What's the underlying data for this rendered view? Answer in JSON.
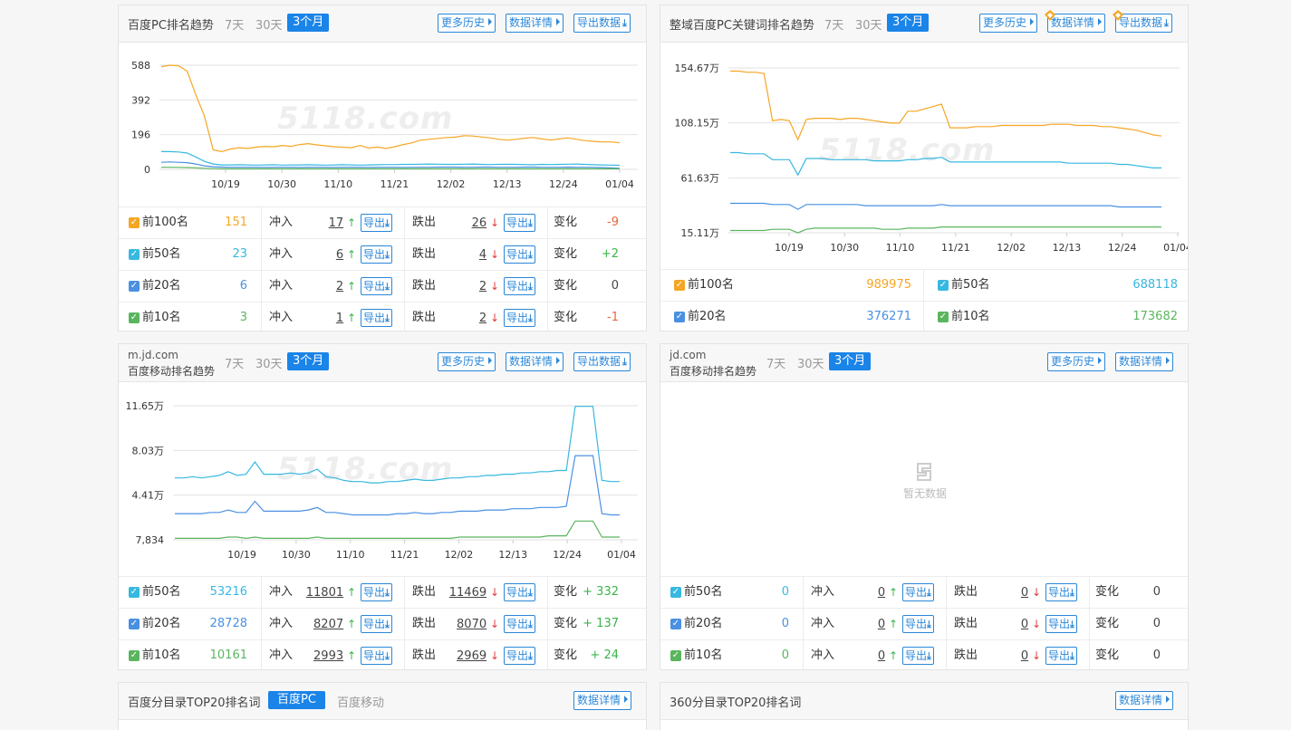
{
  "colors": {
    "orange": "#f5a623",
    "cyan": "#37b8e0",
    "blue": "#4a90e2",
    "green": "#5ab55e",
    "accent": "#1a84e8",
    "red": "#e23b3b",
    "up": "#3ab54a"
  },
  "watermark": "5118.com",
  "panel_tl": {
    "title": "百度PC排名趋势",
    "periods": [
      "7天",
      "30天",
      "3个月"
    ],
    "btn_more": "更多历史",
    "btn_detail": "数据详情",
    "btn_export": "导出数据",
    "rows": [
      {
        "label": "前100名",
        "count": "151",
        "in_label": "冲入",
        "in_val": "17",
        "export": "导出",
        "out_label": "跌出",
        "out_val": "26",
        "change_label": "变化",
        "change": "-9",
        "color": "#f5a623"
      },
      {
        "label": "前50名",
        "count": "23",
        "in_label": "冲入",
        "in_val": "6",
        "export": "导出",
        "out_label": "跌出",
        "out_val": "4",
        "change_label": "变化",
        "change": "+2",
        "color": "#37b8e0"
      },
      {
        "label": "前20名",
        "count": "6",
        "in_label": "冲入",
        "in_val": "2",
        "export": "导出",
        "out_label": "跌出",
        "out_val": "2",
        "change_label": "变化",
        "change": "0",
        "color": "#4a90e2"
      },
      {
        "label": "前10名",
        "count": "3",
        "in_label": "冲入",
        "in_val": "1",
        "export": "导出",
        "out_label": "跌出",
        "out_val": "2",
        "change_label": "变化",
        "change": "-1",
        "color": "#5ab55e"
      }
    ]
  },
  "panel_tr": {
    "title": "整域百度PC关键词排名趋势",
    "periods": [
      "7天",
      "30天",
      "3个月"
    ],
    "btn_more": "更多历史",
    "btn_detail": "数据详情",
    "btn_export": "导出数据",
    "stats": [
      {
        "label": "前100名",
        "value": "989975",
        "color": "#f5a623"
      },
      {
        "label": "前50名",
        "value": "688118",
        "color": "#37b8e0"
      },
      {
        "label": "前20名",
        "value": "376271",
        "color": "#4a90e2"
      },
      {
        "label": "前10名",
        "value": "173682",
        "color": "#5ab55e"
      }
    ]
  },
  "panel_ml": {
    "domain": "m.jd.com",
    "title": "百度移动排名趋势",
    "periods": [
      "7天",
      "30天",
      "3个月"
    ],
    "btn_more": "更多历史",
    "btn_detail": "数据详情",
    "btn_export": "导出数据",
    "rows": [
      {
        "label": "前50名",
        "count": "53216",
        "in_label": "冲入",
        "in_val": "11801",
        "export": "导出",
        "out_label": "跌出",
        "out_val": "11469",
        "change_label": "变化",
        "change": "+ 332",
        "color": "#37b8e0"
      },
      {
        "label": "前20名",
        "count": "28728",
        "in_label": "冲入",
        "in_val": "8207",
        "export": "导出",
        "out_label": "跌出",
        "out_val": "8070",
        "change_label": "变化",
        "change": "+ 137",
        "color": "#4a90e2"
      },
      {
        "label": "前10名",
        "count": "10161",
        "in_label": "冲入",
        "in_val": "2993",
        "export": "导出",
        "out_label": "跌出",
        "out_val": "2969",
        "change_label": "变化",
        "change": "+ 24",
        "color": "#5ab55e"
      }
    ]
  },
  "panel_mr": {
    "domain": "jd.com",
    "title": "百度移动排名趋势",
    "periods": [
      "7天",
      "30天",
      "3个月"
    ],
    "btn_more": "更多历史",
    "btn_detail": "数据详情",
    "nodata": "暂无数据",
    "rows": [
      {
        "label": "前50名",
        "count": "0",
        "in_label": "冲入",
        "in_val": "0",
        "export": "导出",
        "out_label": "跌出",
        "out_val": "0",
        "change_label": "变化",
        "change": "0",
        "color": "#37b8e0"
      },
      {
        "label": "前20名",
        "count": "0",
        "in_label": "冲入",
        "in_val": "0",
        "export": "导出",
        "out_label": "跌出",
        "out_val": "0",
        "change_label": "变化",
        "change": "0",
        "color": "#4a90e2"
      },
      {
        "label": "前10名",
        "count": "0",
        "in_label": "冲入",
        "in_val": "0",
        "export": "导出",
        "out_label": "跌出",
        "out_val": "0",
        "change_label": "变化",
        "change": "0",
        "color": "#5ab55e"
      }
    ]
  },
  "panel_bl": {
    "title": "百度分目录TOP20排名词",
    "tabs": [
      "百度PC",
      "百度移动"
    ],
    "btn_detail": "数据详情"
  },
  "panel_br": {
    "title": "360分目录TOP20排名词",
    "btn_detail": "数据详情"
  },
  "chart_data": [
    {
      "type": "line",
      "x": [
        "10/19",
        "10/30",
        "11/10",
        "11/21",
        "12/02",
        "12/13",
        "12/24",
        "01/04"
      ],
      "yticks": [
        "588",
        "392",
        "196",
        "0"
      ],
      "ylim": [
        0,
        588
      ],
      "series": [
        {
          "color": "#f5a623",
          "values": [
            580,
            588,
            585,
            555,
            420,
            300,
            110,
            100,
            115,
            122,
            118,
            126,
            130,
            128,
            135,
            130,
            140,
            145,
            138,
            133,
            128,
            125,
            122,
            135,
            120,
            126,
            118,
            128,
            140,
            150,
            165,
            170,
            175,
            180,
            182,
            190,
            188,
            183,
            178,
            170,
            165,
            170,
            176,
            180,
            172,
            165,
            172,
            178,
            170,
            162,
            158,
            155,
            155,
            150
          ]
        },
        {
          "color": "#37b8e0",
          "values": [
            100,
            100,
            98,
            92,
            70,
            45,
            30,
            25,
            25,
            26,
            25,
            24,
            25,
            26,
            24,
            25,
            25,
            26,
            25,
            24,
            25,
            26,
            25,
            24,
            25,
            26,
            27,
            27,
            28,
            28,
            29,
            30,
            29,
            28,
            28,
            29,
            30,
            28,
            27,
            28,
            29,
            28,
            27,
            26,
            28,
            27,
            28,
            29,
            30,
            28,
            26,
            25,
            24,
            23
          ]
        },
        {
          "color": "#4a90e2",
          "values": [
            40,
            42,
            40,
            38,
            30,
            20,
            15,
            13,
            12,
            12,
            12,
            12,
            11,
            12,
            12,
            12,
            11,
            12,
            12,
            12,
            11,
            12,
            12,
            12,
            11,
            12,
            12,
            12,
            11,
            12,
            12,
            12,
            13,
            13,
            13,
            12,
            12,
            13,
            13,
            12,
            12,
            12,
            13,
            13,
            12,
            12,
            12,
            13,
            12,
            12,
            11,
            10,
            8,
            6
          ]
        },
        {
          "color": "#5ab55e",
          "values": [
            12,
            12,
            11,
            10,
            8,
            6,
            4,
            3,
            3,
            3,
            3,
            3,
            3,
            3,
            3,
            3,
            3,
            3,
            3,
            3,
            3,
            3,
            3,
            3,
            3,
            3,
            3,
            3,
            3,
            3,
            3,
            3,
            3,
            3,
            3,
            3,
            3,
            3,
            3,
            3,
            3,
            3,
            3,
            3,
            3,
            3,
            3,
            3,
            3,
            3,
            3,
            3,
            3,
            3
          ]
        }
      ]
    },
    {
      "type": "line",
      "x": [
        "10/19",
        "10/30",
        "11/10",
        "11/21",
        "12/02",
        "12/13",
        "12/24",
        "01/04"
      ],
      "yticks": [
        "154.67万",
        "108.15万",
        "61.63万",
        "15.11万"
      ],
      "ylim": [
        15.11,
        154.67
      ],
      "y_unit": "万",
      "series": [
        {
          "color": "#f5a623",
          "values": [
            152,
            152,
            151,
            151,
            150,
            110,
            111,
            110,
            94,
            111,
            112,
            112,
            112,
            111,
            112,
            112,
            111,
            110,
            109,
            108,
            108,
            118,
            118,
            120,
            122,
            124,
            104,
            104,
            104,
            105,
            105,
            105,
            106,
            106,
            106,
            106,
            106,
            106,
            107,
            107,
            107,
            106,
            106,
            106,
            105,
            105,
            104,
            103,
            102,
            100,
            98,
            97
          ]
        },
        {
          "color": "#37b8e0",
          "values": [
            83,
            83,
            82,
            82,
            82,
            77,
            77,
            77,
            64,
            78,
            78,
            78,
            77,
            77,
            77,
            77,
            77,
            76,
            76,
            76,
            76,
            77,
            77,
            78,
            78,
            79,
            75,
            75,
            75,
            75,
            75,
            75,
            75,
            75,
            75,
            75,
            75,
            75,
            75,
            75,
            74,
            74,
            74,
            74,
            74,
            74,
            73,
            73,
            72,
            71,
            70,
            70
          ]
        },
        {
          "color": "#4a90e2",
          "values": [
            40,
            40,
            40,
            40,
            40,
            39,
            39,
            39,
            35,
            39,
            39,
            39,
            39,
            39,
            39,
            39,
            38,
            38,
            38,
            38,
            38,
            38,
            38,
            38,
            38,
            39,
            38,
            38,
            38,
            38,
            38,
            38,
            38,
            38,
            38,
            38,
            38,
            38,
            38,
            38,
            38,
            38,
            38,
            38,
            38,
            38,
            37,
            37,
            37,
            37,
            37,
            37
          ]
        },
        {
          "color": "#5ab55e",
          "values": [
            17,
            17,
            17,
            17,
            17,
            18,
            18,
            18,
            15,
            18,
            19,
            19,
            19,
            19,
            19,
            19,
            19,
            19,
            18,
            18,
            18,
            19,
            19,
            19,
            19,
            20,
            20,
            20,
            20,
            20,
            20,
            20,
            20,
            20,
            20,
            20,
            20,
            20,
            20,
            20,
            20,
            20,
            20,
            20,
            20,
            20,
            20,
            20,
            20,
            20,
            20,
            20
          ]
        }
      ]
    },
    {
      "type": "line",
      "x": [
        "10/19",
        "10/30",
        "11/10",
        "11/21",
        "12/02",
        "12/13",
        "12/24",
        "01/04"
      ],
      "yticks": [
        "11.65万",
        "8.03万",
        "4.41万",
        "7,834"
      ],
      "ylim": [
        0.78,
        11.65
      ],
      "y_unit": "万",
      "series": [
        {
          "color": "#37b8e0",
          "values": [
            5.8,
            5.8,
            5.9,
            5.8,
            5.9,
            6.0,
            6.3,
            6.0,
            6.1,
            7.1,
            6.1,
            6.1,
            6.1,
            6.2,
            6.1,
            6.2,
            6.5,
            5.9,
            5.8,
            5.6,
            5.5,
            5.5,
            5.4,
            5.4,
            5.5,
            5.5,
            5.6,
            5.7,
            5.6,
            5.6,
            5.7,
            5.8,
            5.8,
            5.9,
            5.9,
            6.0,
            6.0,
            6.1,
            6.1,
            6.2,
            6.2,
            6.3,
            6.3,
            6.4,
            6.4,
            11.6,
            11.6,
            11.6,
            5.6,
            5.5,
            5.5
          ]
        },
        {
          "color": "#4a90e2",
          "values": [
            2.9,
            2.9,
            2.9,
            2.9,
            3.0,
            3.0,
            3.2,
            3.0,
            3.0,
            3.9,
            3.1,
            3.1,
            3.1,
            3.1,
            3.1,
            3.2,
            3.4,
            3.0,
            3.0,
            2.9,
            2.8,
            2.8,
            2.8,
            2.8,
            2.8,
            2.9,
            2.9,
            3.0,
            2.9,
            2.9,
            3.0,
            3.0,
            3.1,
            3.1,
            3.1,
            3.2,
            3.2,
            3.2,
            3.3,
            3.3,
            3.3,
            3.4,
            3.4,
            3.4,
            3.5,
            7.6,
            7.6,
            7.6,
            2.9,
            2.8,
            2.8
          ]
        },
        {
          "color": "#5ab55e",
          "values": [
            0.9,
            0.9,
            0.9,
            0.9,
            0.9,
            0.9,
            1.0,
            1.0,
            0.9,
            1.0,
            0.9,
            0.9,
            0.9,
            0.9,
            0.9,
            0.9,
            1.0,
            0.9,
            0.9,
            0.9,
            0.9,
            0.9,
            0.9,
            0.9,
            0.9,
            0.9,
            0.9,
            0.9,
            0.9,
            0.9,
            0.9,
            0.9,
            1.0,
            1.0,
            1.0,
            1.0,
            1.0,
            1.0,
            1.0,
            1.0,
            1.0,
            1.0,
            1.1,
            1.1,
            1.1,
            2.3,
            2.3,
            2.3,
            1.0,
            1.0,
            1.0
          ]
        }
      ]
    }
  ]
}
